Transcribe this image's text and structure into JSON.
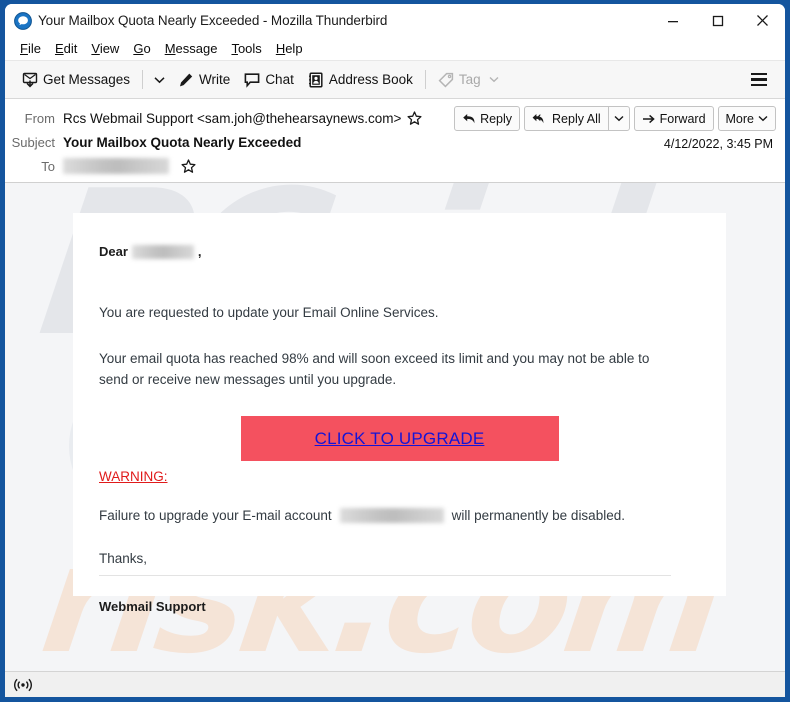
{
  "window": {
    "title": "Your Mailbox Quota Nearly Exceeded - Mozilla Thunderbird",
    "app_icon": "thunderbird-icon",
    "controls": {
      "minimize": "minimize-icon",
      "maximize": "maximize-icon",
      "close": "close-icon"
    },
    "frame_color": "#14559e"
  },
  "menubar": {
    "items": [
      {
        "label": "File",
        "accel": "F"
      },
      {
        "label": "Edit",
        "accel": "E"
      },
      {
        "label": "View",
        "accel": "V"
      },
      {
        "label": "Go",
        "accel": "G"
      },
      {
        "label": "Message",
        "accel": "M"
      },
      {
        "label": "Tools",
        "accel": "T"
      },
      {
        "label": "Help",
        "accel": "H"
      }
    ]
  },
  "toolbar": {
    "get_messages": "Get Messages",
    "write": "Write",
    "chat": "Chat",
    "address_book": "Address Book",
    "tag": "Tag",
    "tag_disabled": true,
    "app_menu": "hamburger-icon"
  },
  "message_header": {
    "from_label": "From",
    "from_value": "Rcs Webmail Support <sam.joh@thehearsaynews.com>",
    "subject_label": "Subject",
    "subject_value": "Your Mailbox Quota Nearly Exceeded",
    "to_label": "To",
    "to_value_redacted": true,
    "date": "4/12/2022, 3:45 PM",
    "actions": {
      "reply": "Reply",
      "reply_all": "Reply All",
      "forward": "Forward",
      "more": "More"
    }
  },
  "mail_body": {
    "greeting_prefix": "Dear",
    "greeting_redacted": true,
    "greeting_suffix": ",",
    "paragraph_1": "You are requested to update your Email Online Services.",
    "paragraph_2": "Your email quota has reached 98% and will soon exceed its limit and you may not be able to send or receive new messages until you upgrade.",
    "cta_label": "CLICK TO UPGRADE",
    "cta_bg_color": "#f4515f",
    "cta_link_color": "#1414d6",
    "warning_label": "WARNING:",
    "warning_color": "#e01b1b",
    "failure_prefix": "Failure to upgrade your E-mail account",
    "failure_redacted": true,
    "failure_suffix": "will permanently be disabled.",
    "closing": "Thanks,",
    "signature": "Webmail Support"
  },
  "watermark": {
    "text": "PCrisk",
    "text2": "risk.com"
  },
  "statusbar": {
    "icon": "broadcast-icon"
  }
}
